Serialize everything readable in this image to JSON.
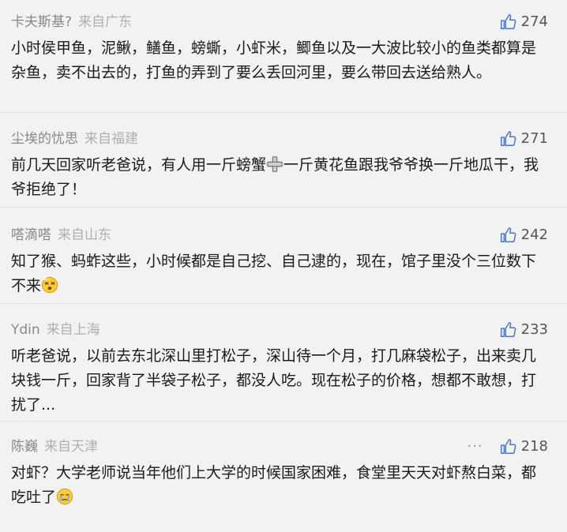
{
  "comments": [
    {
      "username": "卡夫斯基?",
      "location": "来自广东",
      "likes": "274",
      "segments": [
        "小时侯甲鱼，泥鳅，鳝鱼，螃蟖，小虾米，鲫鱼以及一大波比较小的鱼类都算是杂鱼，卖不出去的，打鱼的弄到了要么丢回河里，要么带回去送给熟人。"
      ]
    },
    {
      "username": "尘埃的忧思",
      "location": "来自福建",
      "likes": "271",
      "segments": [
        "前几天回家听老爸说，有人用一斤螃蟹",
        "一斤黄花鱼跟我爷爷换一斤地瓜干，我爷拒绝了！"
      ],
      "emoji": "plus"
    },
    {
      "username": "嗒滴嗒",
      "location": "来自山东",
      "likes": "242",
      "segments": [
        "知了猴、蚂蚱这些，小时候都是自己挖、自己逮的，现在，馆子里没个三位数下不来",
        ""
      ],
      "emoji": "dizzy-face"
    },
    {
      "username": "Ydin",
      "location": "来自上海",
      "likes": "233",
      "segments": [
        "听老爸说，以前去东北深山里打松子，深山待一个月，打几麻袋松子，出来卖几块钱一斤，回家背了半袋子松子，都没人吃。现在松子的价格，想都不敢想，打扰了..."
      ]
    },
    {
      "username": "陈巍",
      "location": "来自天津",
      "likes": "218",
      "more": "···",
      "segments": [
        "对虾？大学老师说当年他们上大学的时候国家困难，食堂里天天对虾熬白菜，都吃吐了",
        ""
      ],
      "emoji": "crying-face"
    }
  ]
}
